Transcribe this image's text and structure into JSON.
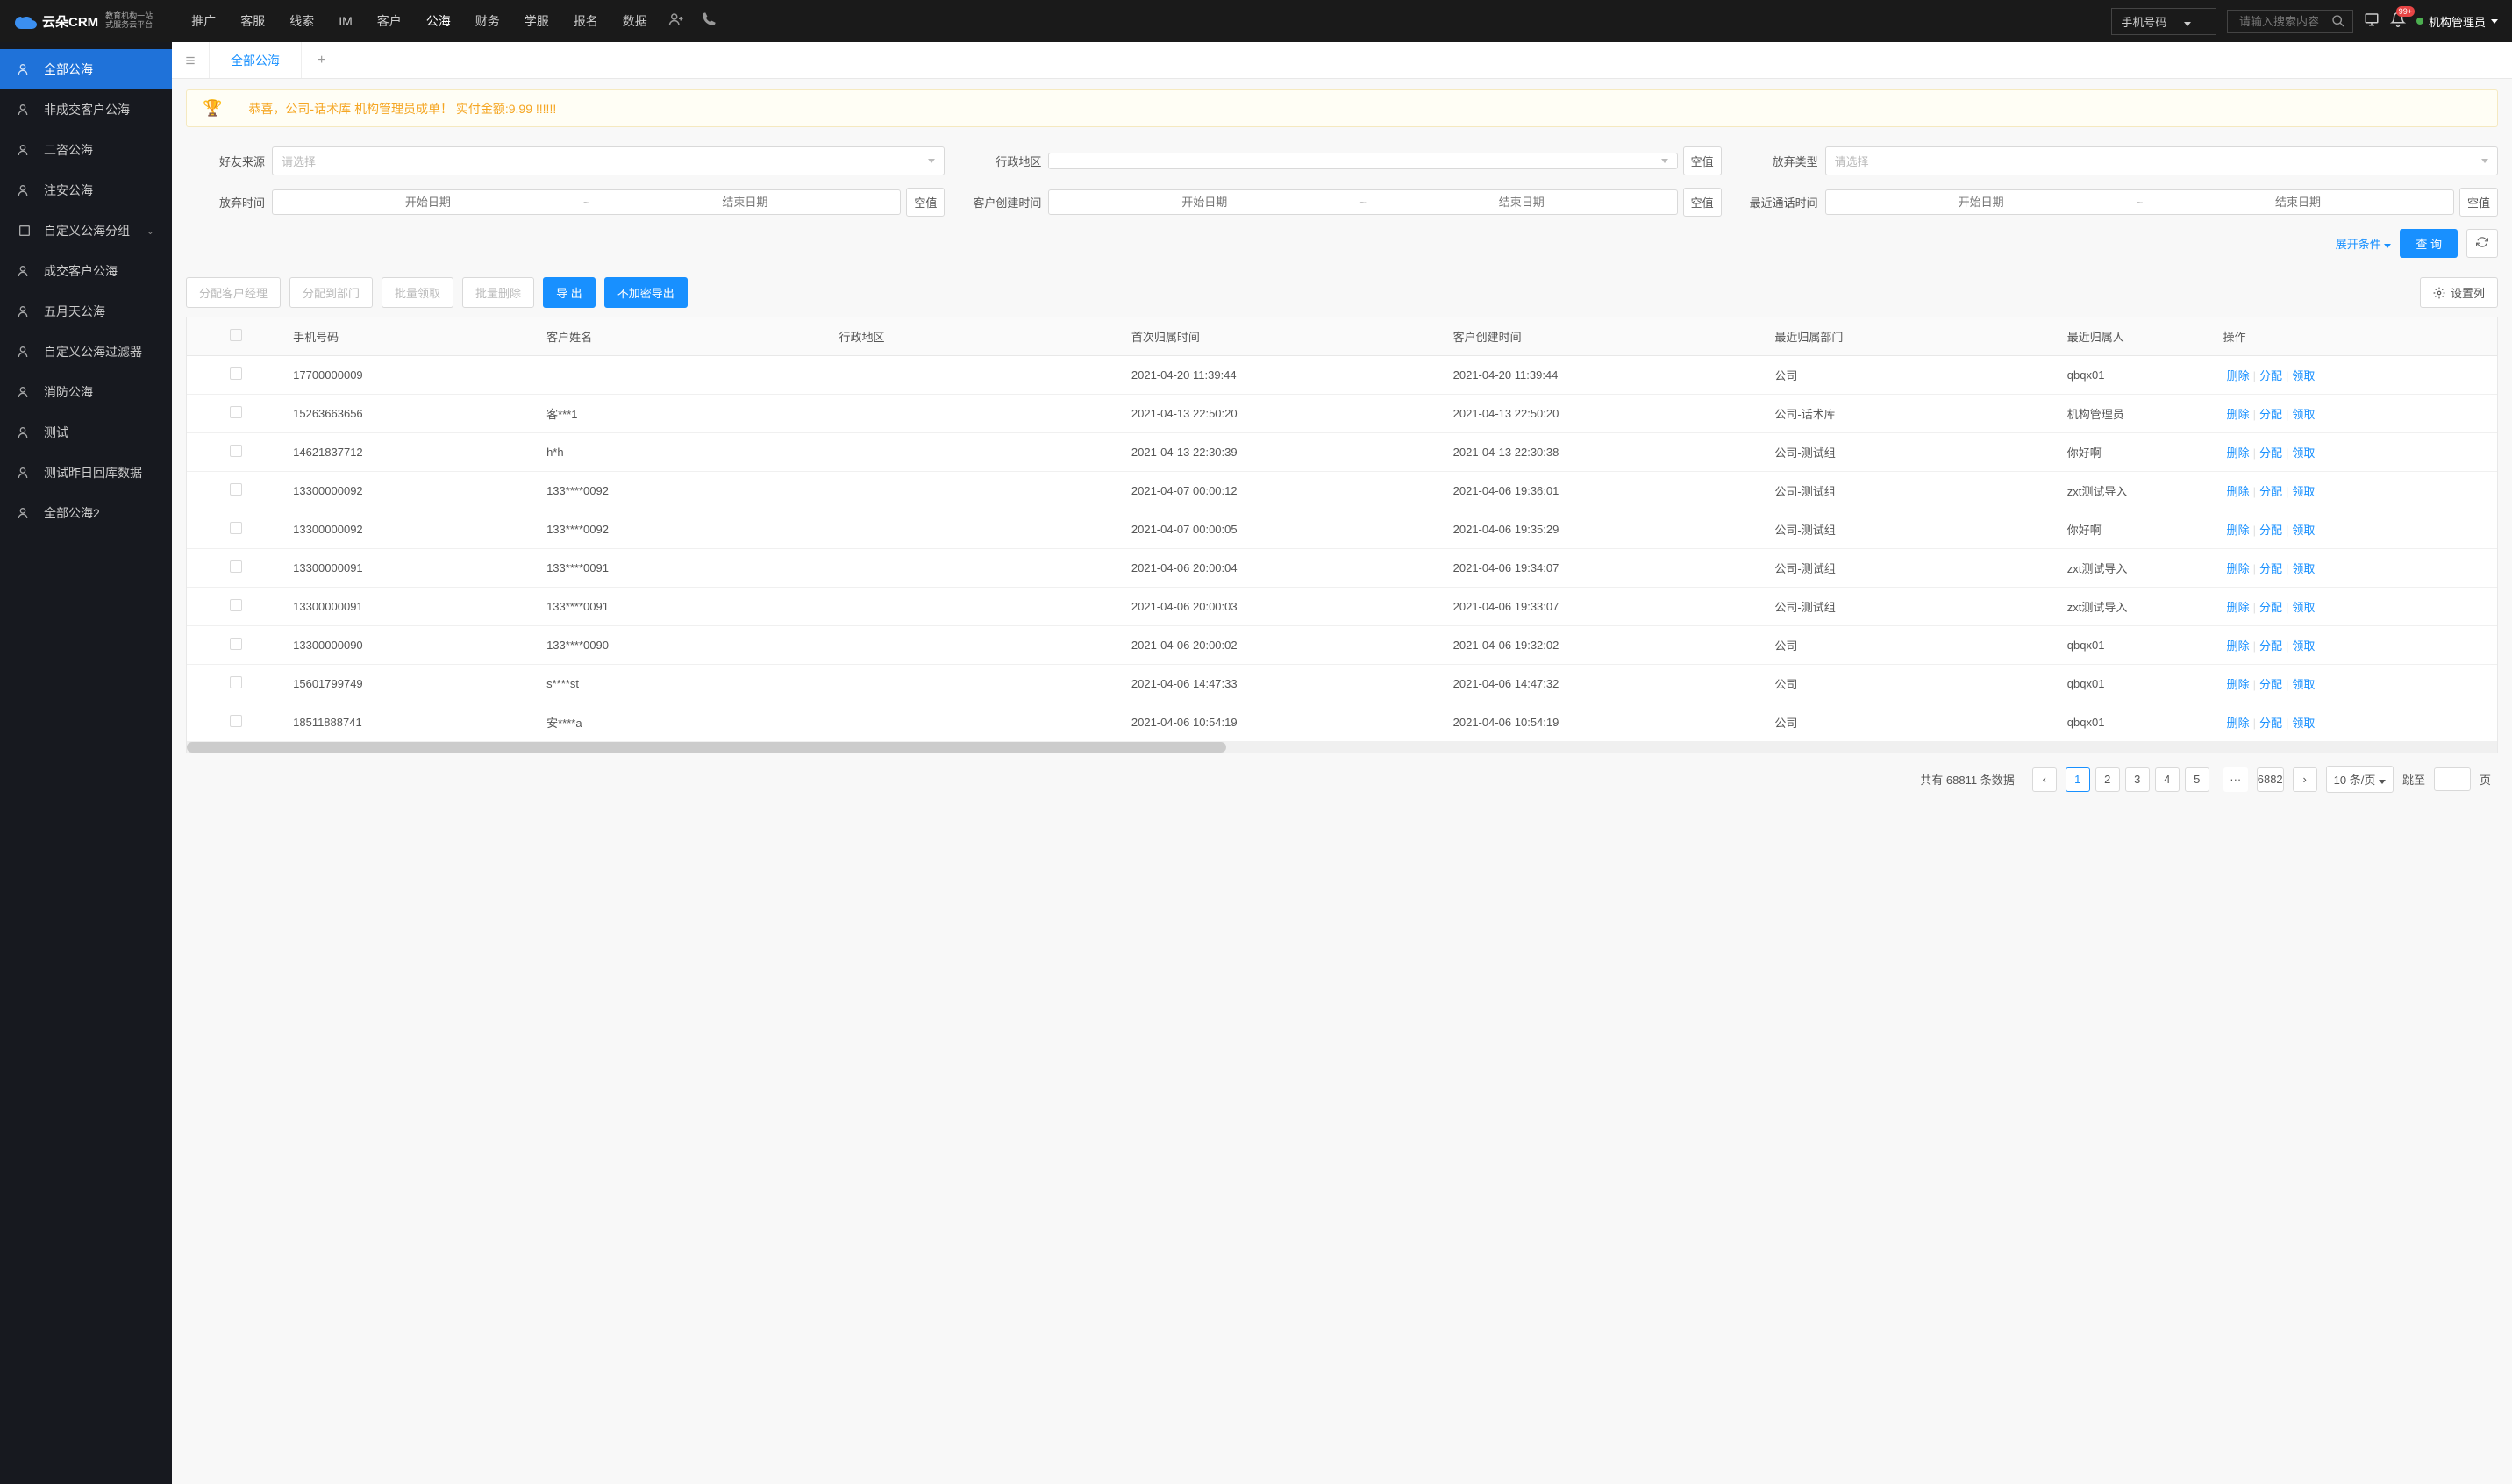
{
  "header": {
    "logo": {
      "main": "云朵CRM",
      "sub1": "教育机构一站",
      "sub2": "式服务云平台",
      "url": "www.yunduocrm.com"
    },
    "nav": [
      "推广",
      "客服",
      "线索",
      "IM",
      "客户",
      "公海",
      "财务",
      "学服",
      "报名",
      "数据"
    ],
    "nav_active_index": 5,
    "search_type": "手机号码",
    "search_placeholder": "请输入搜索内容",
    "badge": "99+",
    "user": "机构管理员"
  },
  "sidebar": {
    "items": [
      {
        "label": "全部公海",
        "active": true
      },
      {
        "label": "非成交客户公海"
      },
      {
        "label": "二咨公海"
      },
      {
        "label": "注安公海"
      },
      {
        "label": "自定义公海分组",
        "expandable": true
      },
      {
        "label": "成交客户公海"
      },
      {
        "label": "五月天公海"
      },
      {
        "label": "自定义公海过滤器"
      },
      {
        "label": "消防公海"
      },
      {
        "label": "测试"
      },
      {
        "label": "测试昨日回库数据"
      },
      {
        "label": "全部公海2"
      }
    ]
  },
  "tabs": {
    "active": "全部公海"
  },
  "notice": "恭喜，公司-话术库  机构管理员成单！  实付金额:9.99 !!!!!!",
  "filters": {
    "friend_source": {
      "label": "好友来源",
      "placeholder": "请选择"
    },
    "region": {
      "label": "行政地区",
      "placeholder": "",
      "empty": "空值"
    },
    "abandon_type": {
      "label": "放弃类型",
      "placeholder": "请选择"
    },
    "abandon_time": {
      "label": "放弃时间",
      "start": "开始日期",
      "end": "结束日期",
      "empty": "空值"
    },
    "create_time": {
      "label": "客户创建时间",
      "start": "开始日期",
      "end": "结束日期",
      "empty": "空值"
    },
    "last_call": {
      "label": "最近通话时间",
      "start": "开始日期",
      "end": "结束日期",
      "empty": "空值"
    },
    "expand": "展开条件",
    "query": "查 询"
  },
  "toolbar": {
    "assign_manager": "分配客户经理",
    "assign_dept": "分配到部门",
    "batch_claim": "批量领取",
    "batch_delete": "批量删除",
    "export": "导 出",
    "export_plain": "不加密导出",
    "settings": "设置列"
  },
  "table": {
    "columns": [
      "手机号码",
      "客户姓名",
      "行政地区",
      "首次归属时间",
      "客户创建时间",
      "最近归属部门",
      "最近归属人",
      "操作"
    ],
    "actions": {
      "delete": "删除",
      "assign": "分配",
      "claim": "领取"
    },
    "rows": [
      {
        "phone": "17700000009",
        "name": "",
        "region": "",
        "first_time": "2021-04-20 11:39:44",
        "create_time": "2021-04-20 11:39:44",
        "dept": "公司",
        "person": "qbqx01"
      },
      {
        "phone": "15263663656",
        "name": "客***1",
        "region": "",
        "first_time": "2021-04-13 22:50:20",
        "create_time": "2021-04-13 22:50:20",
        "dept": "公司-话术库",
        "person": "机构管理员"
      },
      {
        "phone": "14621837712",
        "name": "h*h",
        "region": "",
        "first_time": "2021-04-13 22:30:39",
        "create_time": "2021-04-13 22:30:38",
        "dept": "公司-测试组",
        "person": "你好啊"
      },
      {
        "phone": "13300000092",
        "name": "133****0092",
        "region": "",
        "first_time": "2021-04-07 00:00:12",
        "create_time": "2021-04-06 19:36:01",
        "dept": "公司-测试组",
        "person": "zxt测试导入"
      },
      {
        "phone": "13300000092",
        "name": "133****0092",
        "region": "",
        "first_time": "2021-04-07 00:00:05",
        "create_time": "2021-04-06 19:35:29",
        "dept": "公司-测试组",
        "person": "你好啊"
      },
      {
        "phone": "13300000091",
        "name": "133****0091",
        "region": "",
        "first_time": "2021-04-06 20:00:04",
        "create_time": "2021-04-06 19:34:07",
        "dept": "公司-测试组",
        "person": "zxt测试导入"
      },
      {
        "phone": "13300000091",
        "name": "133****0091",
        "region": "",
        "first_time": "2021-04-06 20:00:03",
        "create_time": "2021-04-06 19:33:07",
        "dept": "公司-测试组",
        "person": "zxt测试导入"
      },
      {
        "phone": "13300000090",
        "name": "133****0090",
        "region": "",
        "first_time": "2021-04-06 20:00:02",
        "create_time": "2021-04-06 19:32:02",
        "dept": "公司",
        "person": "qbqx01"
      },
      {
        "phone": "15601799749",
        "name": "s****st",
        "region": "",
        "first_time": "2021-04-06 14:47:33",
        "create_time": "2021-04-06 14:47:32",
        "dept": "公司",
        "person": "qbqx01"
      },
      {
        "phone": "18511888741",
        "name": "安****a",
        "region": "",
        "first_time": "2021-04-06 10:54:19",
        "create_time": "2021-04-06 10:54:19",
        "dept": "公司",
        "person": "qbqx01"
      }
    ]
  },
  "pagination": {
    "total_prefix": "共有",
    "total": "68811",
    "total_suffix": "条数据",
    "pages": [
      "1",
      "2",
      "3",
      "4",
      "5"
    ],
    "last_page": "6882",
    "per_page": "10 条/页",
    "goto_label": "跳至",
    "goto_suffix": "页"
  }
}
